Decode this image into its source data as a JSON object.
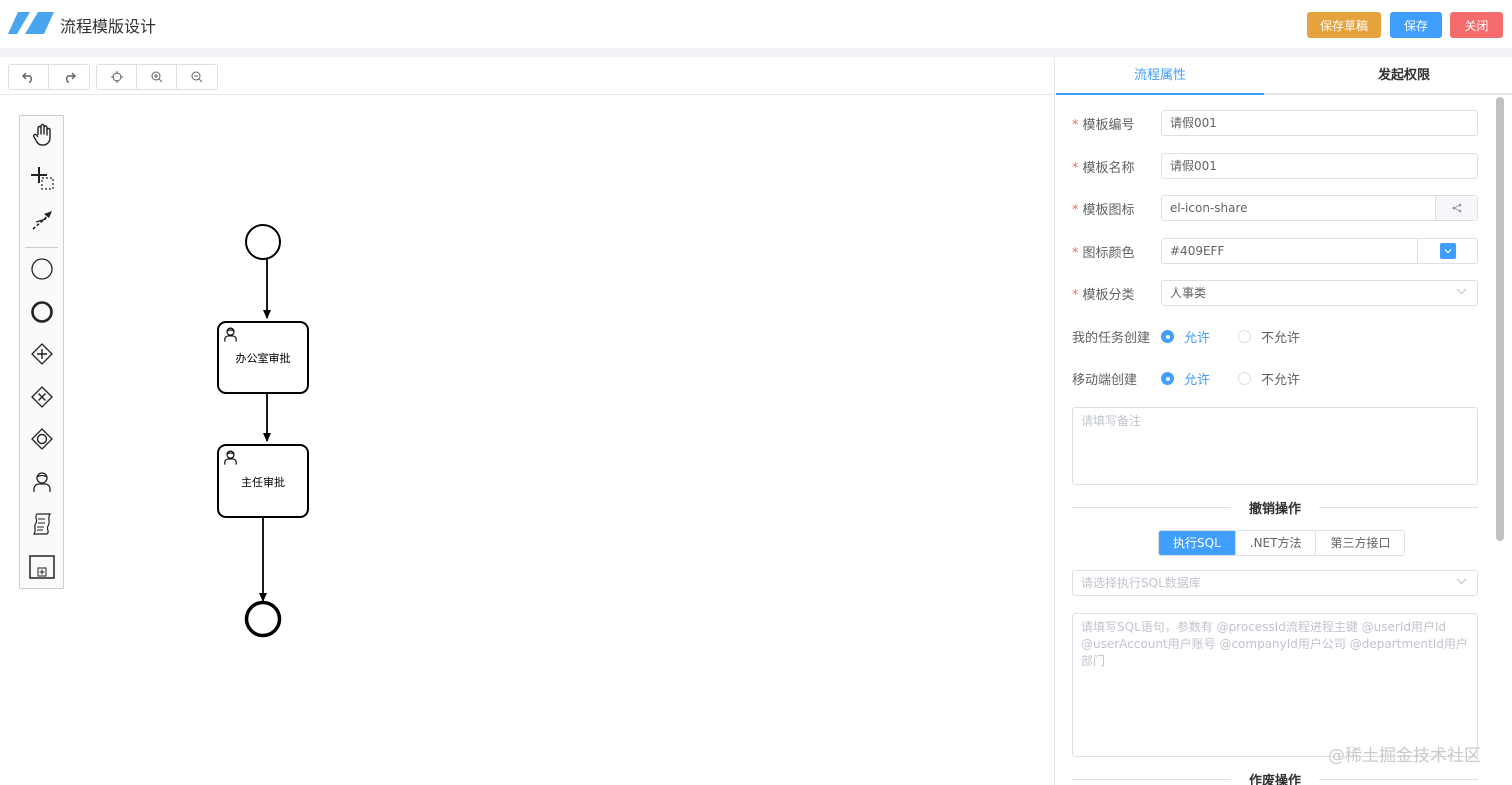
{
  "header": {
    "title": "流程模版设计",
    "save_draft_label": "保存草稿",
    "save_label": "保存",
    "close_label": "关闭"
  },
  "toolbar": {
    "icons": [
      "undo-icon",
      "redo-icon",
      "fit-view-icon",
      "zoom-in-icon",
      "zoom-out-icon"
    ]
  },
  "palette": {
    "items": [
      "hand-tool-icon",
      "lasso-tool-icon",
      "connect-tool-icon",
      "start-event-icon",
      "end-event-icon",
      "parallel-gateway-icon",
      "exclusive-gateway-icon",
      "inclusive-gateway-icon",
      "user-task-icon",
      "script-task-icon",
      "subprocess-icon"
    ]
  },
  "diagram": {
    "tasks": [
      {
        "label": "办公室审批"
      },
      {
        "label": "主任审批"
      }
    ]
  },
  "panel": {
    "tabs": [
      {
        "label": "流程属性"
      },
      {
        "label": "发起权限"
      }
    ],
    "fields": {
      "template_code": {
        "label": "模板编号",
        "value": "请假001"
      },
      "template_name": {
        "label": "模板名称",
        "value": "请假001"
      },
      "template_icon": {
        "label": "模板图标",
        "value": "el-icon-share"
      },
      "icon_color": {
        "label": "图标颜色",
        "value": "#409EFF"
      },
      "template_category": {
        "label": "模板分类",
        "value": "人事类"
      }
    },
    "my_task_create": {
      "label": "我的任务创建",
      "options": [
        "允许",
        "不允许"
      ],
      "selected": "允许"
    },
    "mobile_create": {
      "label": "移动端创建",
      "options": [
        "允许",
        "不允许"
      ],
      "selected": "允许"
    },
    "remark_placeholder": "请填写备注",
    "cancel_section_title": "撤销操作",
    "cancel_tabs": [
      "执行SQL",
      ".NET方法",
      "第三方接口"
    ],
    "sql_db_placeholder": "请选择执行SQL数据库",
    "sql_placeholder": "请填写SQL语句，参数有 @processId流程进程主键 @userId用户Id @userAccount用户账号 @companyId用户公司 @departmentId用户部门",
    "void_section_title": "作废操作"
  },
  "watermark": "@稀土掘金技术社区",
  "colors": {
    "primary": "#409EFF",
    "warning": "#E6A23C",
    "danger": "#F56C6C"
  }
}
